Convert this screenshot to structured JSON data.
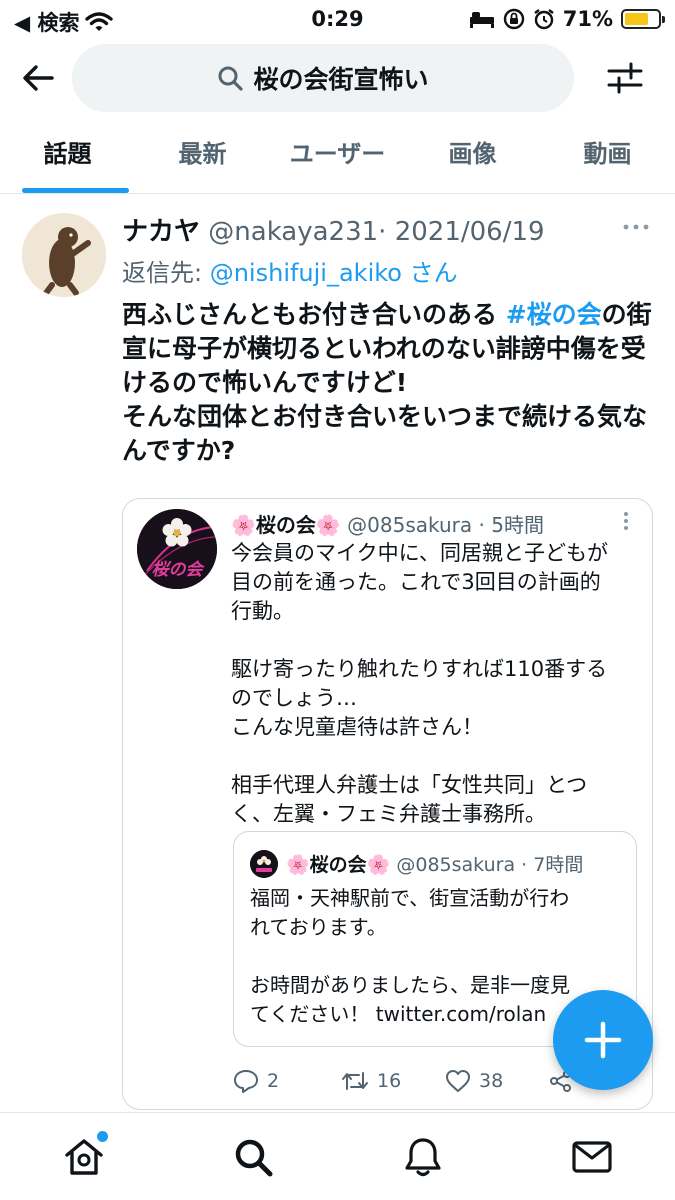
{
  "status_bar": {
    "back_app": "◀ 検索",
    "time": "0:29",
    "battery_percent": "71%",
    "battery_level": 0.71
  },
  "search": {
    "query": "桜の会街宣怖い"
  },
  "tabs": [
    {
      "label": "話題",
      "active": true
    },
    {
      "label": "最新",
      "active": false
    },
    {
      "label": "ユーザー",
      "active": false
    },
    {
      "label": "画像",
      "active": false
    },
    {
      "label": "動画",
      "active": false
    }
  ],
  "tweet": {
    "name": "ナカヤ",
    "handle": "@nakaya231",
    "sep": "·",
    "date": "2021/06/19",
    "reply_prefix": "返信先: ",
    "reply_handle": "@nishifuji_akiko",
    "reply_suffix": "さん",
    "text_part1": "西ふじさんともお付き合いのある ",
    "hashtag": "#桜の会",
    "text_part2": "の街宣に母子が横切るといわれのない誹謗中傷を受けるので怖いんですけど!\nそんな団体とお付き合いをいつまで続ける気なんですか?"
  },
  "quote": {
    "avatar_text": "桜の会",
    "name": "🌸桜の会🌸",
    "handle": "@085sakura",
    "time": "· 5時間",
    "lines": [
      "今会員のマイク中に、同居親と子どもが",
      "目の前を通った。これで3回目の計画的",
      "行動。",
      "",
      "駆け寄ったり触れたりすれば110番する",
      "のでしょう…",
      "こんな児童虐待は許さん！",
      "",
      "相手代理人弁護士は「女性共同」とつ",
      "く、左翼・フェミ弁護士事務所。"
    ],
    "nested": {
      "name": "🌸桜の会🌸",
      "handle": "@085sakura",
      "time": "· 7時間",
      "lines": [
        "福岡・天神駅前で、街宣活動が行わ",
        "れております。",
        "",
        "お時間がありましたら、是非一度見",
        "てください！ twitter.com/rolan"
      ]
    },
    "actions": {
      "replies": "2",
      "retweets": "16",
      "likes": "38"
    }
  },
  "colors": {
    "accent": "#1d9bf0",
    "text": "#0f1419",
    "muted": "#536471",
    "border": "#cfd9de"
  },
  "icons": [
    "back-arrow-icon",
    "search-icon",
    "filter-icon",
    "more-icon",
    "reply-icon",
    "retweet-icon",
    "like-icon",
    "share-icon",
    "compose-icon",
    "home-icon",
    "explore-icon",
    "notifications-icon",
    "messages-icon"
  ]
}
